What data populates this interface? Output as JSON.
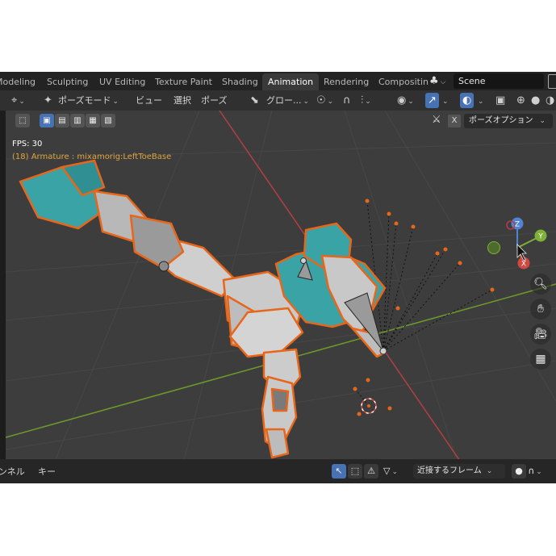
{
  "workspace_tabs": [
    "Modeling",
    "Sculpting",
    "UV Editing",
    "Texture Paint",
    "Shading",
    "Animation",
    "Rendering",
    "Compositin"
  ],
  "active_tab": "Animation",
  "scene": {
    "label": "Scene",
    "icon": "scene-icon"
  },
  "header": {
    "editor_icon": "pose-transform-icon",
    "mode": "ポーズモード",
    "view": "ビュー",
    "select": "選択",
    "pose": "ポーズ",
    "transform_orientation": "グロー...",
    "icons": [
      "pivot-icon",
      "snap-icon",
      "proportional-icon",
      "overlay-icon",
      "gizmo-icon",
      "xray-icon",
      "wireframe-shading-icon",
      "solid-shading-icon",
      "material-shading-icon"
    ]
  },
  "viewport": {
    "fps_text": "FPS: 30",
    "active_object_text": "(18) Armature : mixamorig:LeftToeBase",
    "pose_options_label": "ポーズオプション",
    "pose_options_x": "X",
    "gizmo_axes": {
      "x": "X",
      "y": "Y",
      "z": "Z"
    },
    "nav_icons": [
      "zoom-icon",
      "pan-hand-icon",
      "camera-icon",
      "ortho-grid-icon"
    ],
    "colors": {
      "background": "#3d3d3d",
      "selection_outline": "#e8661a",
      "x_axis": "#b24040",
      "y_axis": "#6e9a2a"
    }
  },
  "timeline": {
    "channel_label": "ンネル",
    "key_label": "キー",
    "snap_label": "近接するフレーム",
    "accent_color": "#4772b3"
  }
}
